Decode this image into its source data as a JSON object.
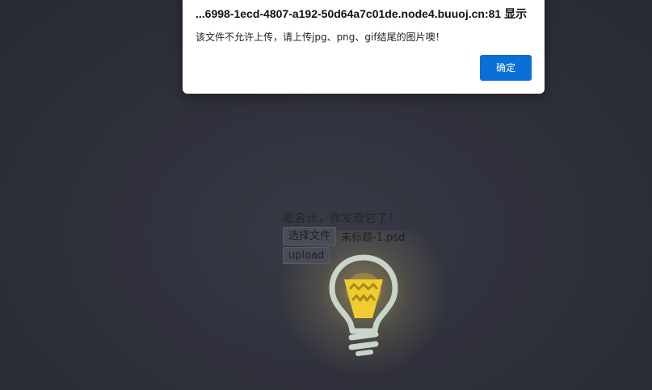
{
  "dialog": {
    "title": "...6998-1ecd-4807-a192-50d64a7c01de.node4.buuoj.cn:81 显示",
    "message": "该文件不允许上传，请上传jpg、png、gif结尾的图片噢！",
    "ok_label": "确定"
  },
  "page": {
    "heading": "匿名计，你发现它了！",
    "file_button_label": "选择文件",
    "file_name": "未标题-1.psd",
    "upload_label": "upload"
  },
  "icons": {
    "bulb": "lightbulb-icon"
  },
  "colors": {
    "background": "#32343f",
    "accent": "#0a6fd6",
    "bulb_yellow": "#f2cc2e",
    "bulb_outline": "#c8d5c8"
  }
}
